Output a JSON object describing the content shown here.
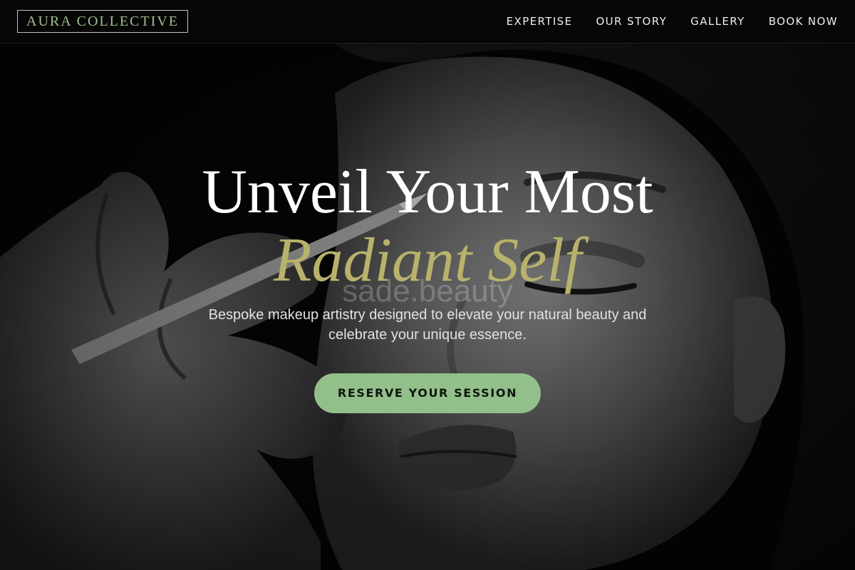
{
  "header": {
    "logo": "AURA COLLECTIVE",
    "nav": [
      {
        "label": "EXPERTISE"
      },
      {
        "label": "OUR STORY"
      },
      {
        "label": "GALLERY"
      },
      {
        "label": "BOOK NOW"
      }
    ]
  },
  "hero": {
    "headline_line1": "Unveil Your Most",
    "headline_line2": "Radiant Self",
    "watermark": "sade.beauty",
    "subtitle": "Bespoke makeup artistry designed to elevate your natural beauty and celebrate your unique essence.",
    "cta_label": "RESERVE YOUR SESSION",
    "image_description": "Black-and-white close-up of a woman with closed eyes having makeup applied with a pencil by a hand"
  },
  "colors": {
    "accent_green": "#93bf8b",
    "headline_gold": "#b9b26c",
    "logo_green": "#9fc08f",
    "header_bg": "#060606"
  }
}
